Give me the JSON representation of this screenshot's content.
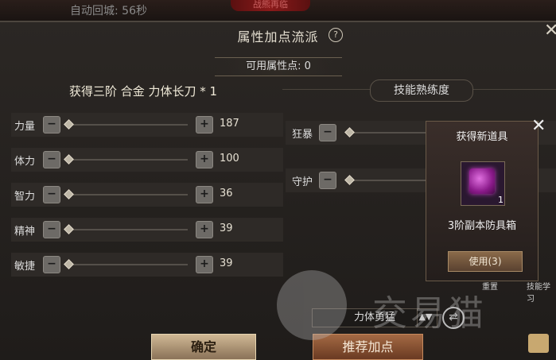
{
  "header": {
    "auto_return": "自动回城: 56秒",
    "banner": "战熊再临",
    "title": "属性加点流派",
    "help": "?",
    "close": "✕"
  },
  "available_points": "可用属性点: 0",
  "obtained_item_header": "获得三阶 合金 力体长刀 * 1",
  "attributes": [
    {
      "label": "力量",
      "value": "187"
    },
    {
      "label": "体力",
      "value": "100"
    },
    {
      "label": "智力",
      "value": "36"
    },
    {
      "label": "精神",
      "value": "39"
    },
    {
      "label": "敏捷",
      "value": "39"
    }
  ],
  "skill": {
    "header": "技能熟练度",
    "items": [
      {
        "label": "狂暴"
      },
      {
        "label": "守护"
      }
    ]
  },
  "popup": {
    "title": "获得新道具",
    "qty": "1",
    "item_name": "3阶副本防具箱",
    "use_label": "使用(3)",
    "close": "✕"
  },
  "side_labels": {
    "reset": "重置",
    "skill_learn": "技能学习"
  },
  "scheme": {
    "selected": "力体勇猛",
    "arrow": "▲▼"
  },
  "buttons": {
    "confirm": "确定",
    "recommend": "推荐加点"
  },
  "watermark": "交易猫",
  "btn_glyphs": {
    "minus": "−",
    "plus": "+",
    "swap": "⇄"
  }
}
